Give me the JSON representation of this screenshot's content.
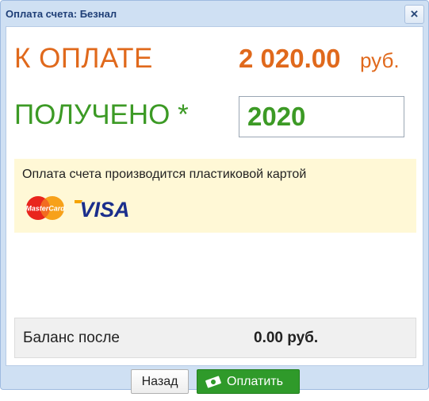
{
  "dialog": {
    "title": "Оплата счета: Безнал",
    "close_symbol": "×"
  },
  "payment": {
    "to_pay_label": "К ОПЛАТЕ",
    "amount": "2 020.00",
    "currency": "руб.",
    "received_label": "ПОЛУЧЕНО *",
    "received_value": "2020"
  },
  "card_info": {
    "text": "Оплата счета производится пластиковой картой",
    "logos": [
      "mastercard-logo",
      "visa-logo"
    ]
  },
  "balance": {
    "label": "Баланс после",
    "value": "0.00 руб."
  },
  "buttons": {
    "back_label": "Назад",
    "pay_label": "Оплатить",
    "pay_icon": "money-icon"
  },
  "colors": {
    "accent_orange": "#e0691c",
    "accent_green": "#3c9a25",
    "pay_button": "#2f9a2a",
    "info_background": "#fff8d6"
  }
}
